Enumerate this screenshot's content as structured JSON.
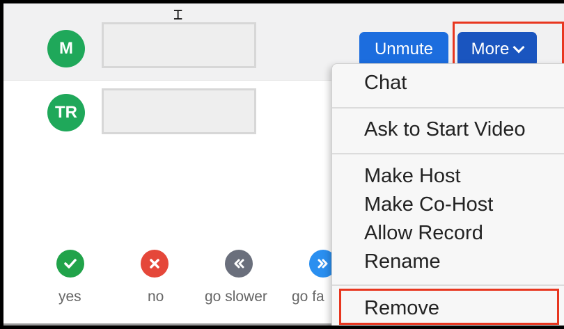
{
  "participants": [
    {
      "initials": "M",
      "avatar_color": "#1fa85a"
    },
    {
      "initials": "TR",
      "avatar_color": "#1fa85a"
    }
  ],
  "buttons": {
    "unmute_label": "Unmute",
    "more_label": "More"
  },
  "menu": {
    "items": [
      "Chat",
      "Ask to Start Video",
      "Make Host",
      "Make Co-Host",
      "Allow Record",
      "Rename",
      "Remove"
    ]
  },
  "reactions": [
    {
      "label": "yes",
      "icon": "check-icon",
      "color": "#21a34a"
    },
    {
      "label": "no",
      "icon": "x-icon",
      "color": "#e5473a"
    },
    {
      "label": "go slower",
      "icon": "rewind-icon",
      "color": "#6a6f7c"
    },
    {
      "label": "go fa",
      "icon": "fast-forward-icon",
      "color": "#2a8ff0"
    }
  ],
  "colors": {
    "primary_button": "#1c6dde",
    "highlight": "#e8361f"
  }
}
